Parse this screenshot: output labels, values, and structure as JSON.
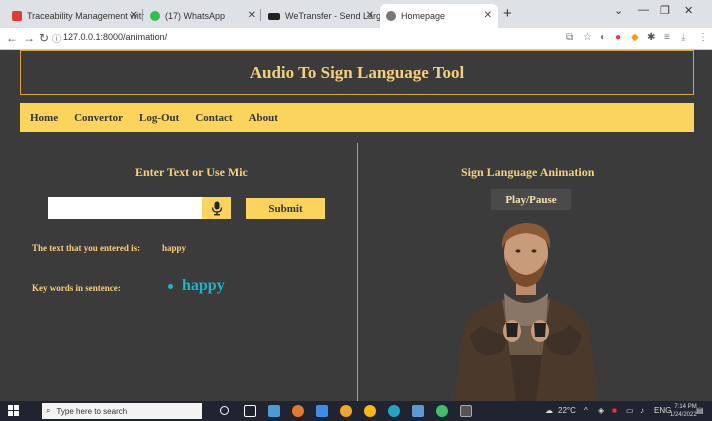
{
  "browser": {
    "tabs": [
      {
        "title": "Traceability Management with H",
        "color": "#e53935"
      },
      {
        "title": "(17) WhatsApp",
        "color": "#2fbf4f"
      },
      {
        "title": "WeTransfer - Send Large Files &",
        "color": "#222222"
      },
      {
        "title": "Homepage",
        "color": "#777777"
      }
    ],
    "new_tab": "+",
    "url": "127.0.0.1:8000/animation/"
  },
  "app": {
    "title": "Audio To Sign Language Tool",
    "menu": [
      "Home",
      "Convertor",
      "Log-Out",
      "Contact",
      "About"
    ],
    "left": {
      "heading": "Enter Text or Use Mic",
      "input_value": "",
      "submit_label": "Submit",
      "entered_label": "The text that you entered is:",
      "entered_value": "happy",
      "keywords_label": "Key words in sentence:",
      "keywords": [
        "happy"
      ]
    },
    "right": {
      "heading": "Sign Language Animation",
      "play_label": "Play/Pause"
    }
  },
  "taskbar": {
    "search_placeholder": "Type here to search",
    "temperature": "22°C",
    "time": "7:14 PM",
    "date": "1/24/2022"
  },
  "colors": {
    "accent": "#fbd55b",
    "heading": "#f5d27a",
    "keyword": "#19b6c9",
    "background": "#3b3b3b"
  }
}
